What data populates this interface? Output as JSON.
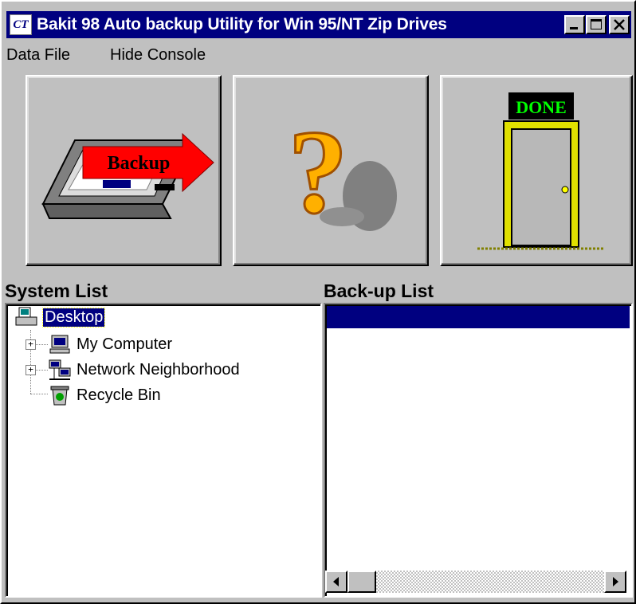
{
  "window": {
    "title": "Bakit 98 Auto backup Utility for Win 95/NT Zip Drives",
    "app_icon_text": "CT"
  },
  "menu": {
    "items": [
      {
        "label": "Data File"
      },
      {
        "label": "Hide Console"
      }
    ]
  },
  "toolbar": {
    "backup_label": "Backup",
    "help_glyph": "?",
    "done_label": "DONE"
  },
  "system_list": {
    "heading": "System List",
    "items": [
      {
        "label": "Desktop",
        "selected": true,
        "icon": "desktop-icon"
      },
      {
        "label": "My Computer",
        "icon": "computer-icon"
      },
      {
        "label": "Network Neighborhood",
        "icon": "network-icon"
      },
      {
        "label": "Recycle Bin",
        "icon": "recycle-bin-icon"
      }
    ]
  },
  "backup_list": {
    "heading": "Back-up List",
    "items": []
  },
  "colors": {
    "title_bar": "#000080",
    "face": "#c0c0c0",
    "selection": "#000080",
    "done_sign_text": "#00ff00",
    "backup_arrow": "#ff0000",
    "question_mark": "#ffb000"
  }
}
